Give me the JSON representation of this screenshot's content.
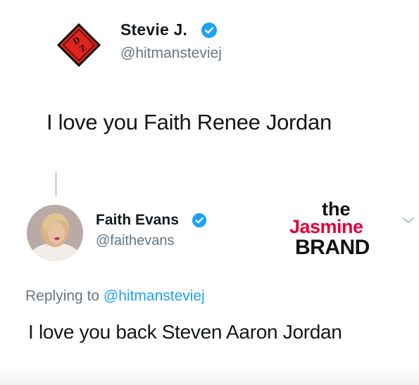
{
  "tweet1": {
    "display_name": "Stevie J.",
    "handle": "@hitmansteviej",
    "text": "I love you Faith Renee Jordan",
    "avatar_icon": "dz-diamond-logo-icon",
    "avatar_color": "#e0231c",
    "verified_icon": "verified-badge-icon"
  },
  "tweet2": {
    "display_name": "Faith Evans",
    "handle": "@faithevans",
    "reply_prefix": "Replying to",
    "reply_to": "@hitmansteviej",
    "text": "I love you back Steven Aaron Jordan",
    "avatar_icon": "profile-photo-icon",
    "verified_icon": "verified-badge-icon",
    "menu_icon": "chevron-down-icon"
  },
  "watermark": {
    "line1": "the",
    "line2": "Jasmine",
    "line3": "BRAND"
  },
  "colors": {
    "verified_blue": "#1da1f2",
    "secondary_text": "#657786",
    "brand_red": "#e2003c"
  }
}
